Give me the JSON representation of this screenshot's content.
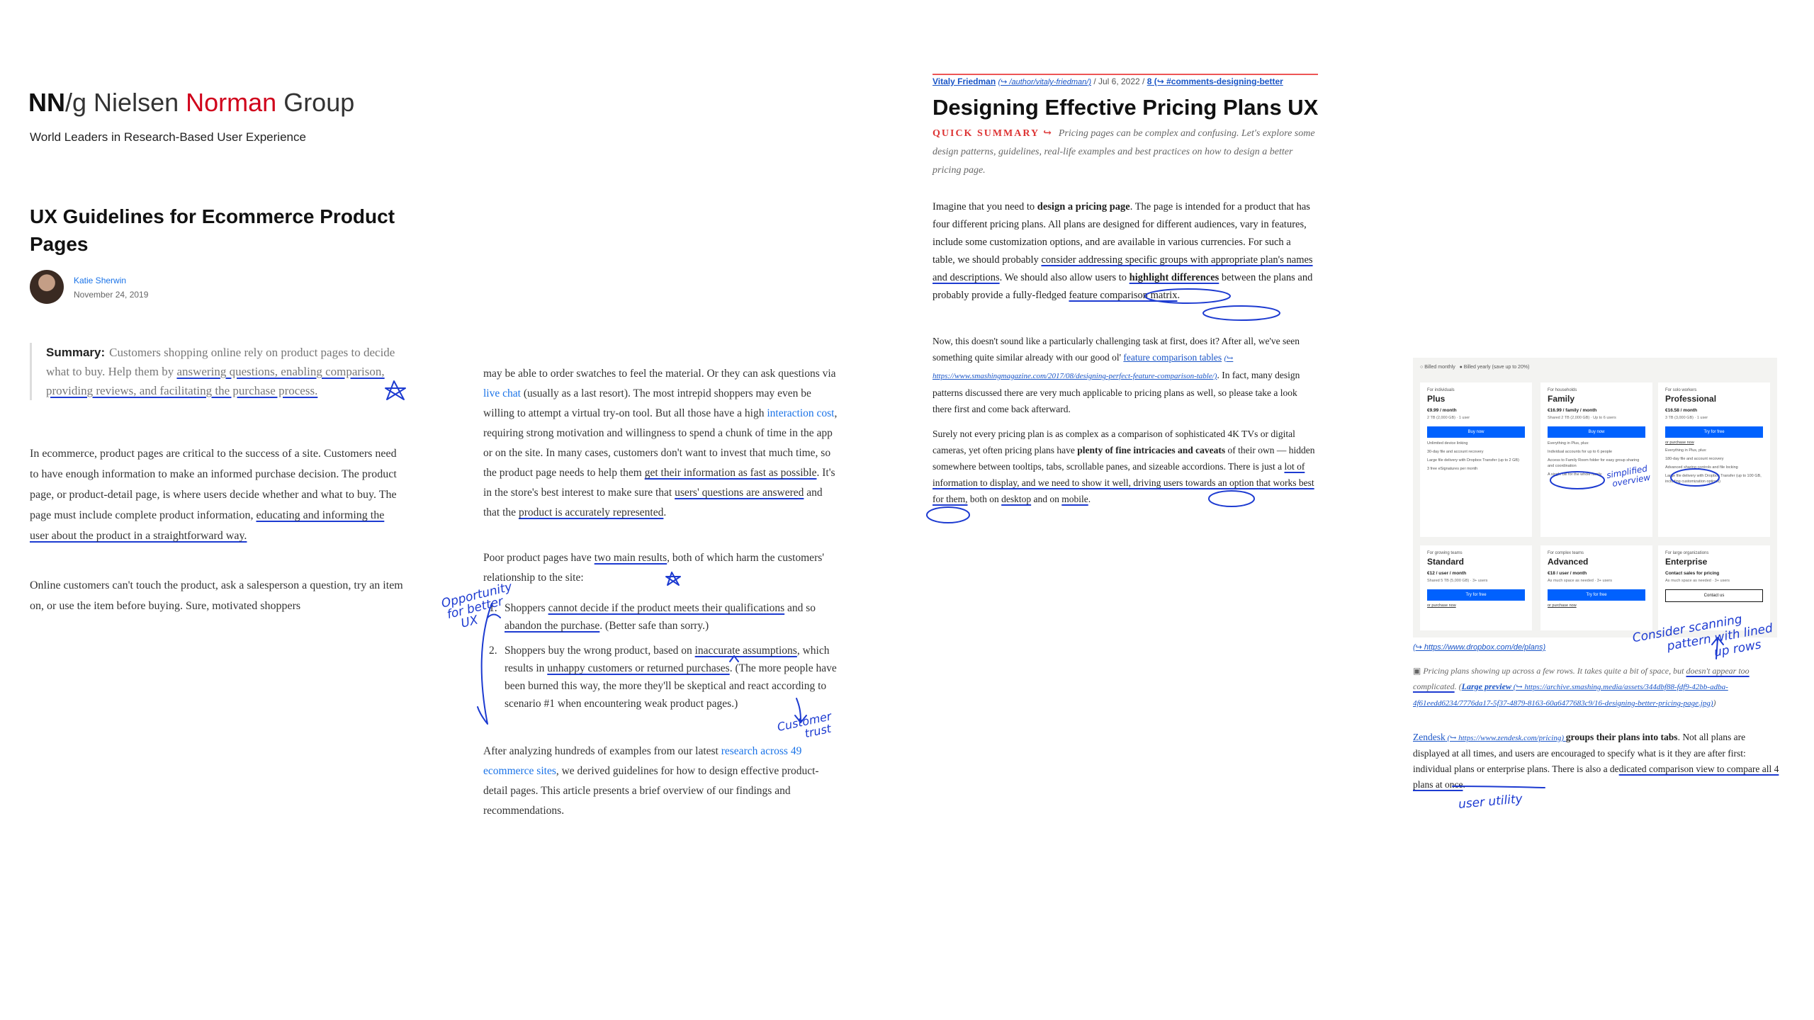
{
  "nng": {
    "logo_nn": "NN",
    "logo_g": "/g",
    "logo_nielsen": "Nielsen",
    "logo_norman": "Norman",
    "logo_group": "Group",
    "tagline": "World Leaders in Research-Based User Experience",
    "title": "UX Guidelines for Ecommerce Product Pages",
    "author": "Katie Sherwin",
    "date": "November 24, 2019",
    "summary_label": "Summary:",
    "summary_a": "Customers shopping online rely on product pages to decide what to buy. Help them by ",
    "summary_b": "answering questions, enabling comparison, providing reviews, and facilitating the purchase process.",
    "p1_a": "In ecommerce, product pages are critical to the success of a site. Customers need to have enough information to make an informed purchase decision. The product page, or product-detail page, is where users decide whether and what to buy. The page must include complete product information, ",
    "p1_b": "educating and informing the user about the product in a straightforward way.",
    "p2": "Online customers can't touch the product, ask a salesperson a question, try an item on, or use the item before buying. Sure, motivated shoppers"
  },
  "col2": {
    "p1_a": "may be able to order swatches to feel the material. Or they can ask questions via ",
    "p1_link1": "live chat",
    "p1_b": " (usually as a last resort). The most intrepid shoppers may even be willing to attempt a virtual try-on tool. But all those  have a high ",
    "p1_link2": "interaction cost",
    "p1_c": ", requiring strong motivation and willingness to spend a chunk of time in the app or on the site. In many cases, customers don't want to invest that much time, so the product page needs to help them ",
    "p1_d": "get their information as fast as possible",
    "p1_e": ". It's in the store's best interest to make sure that ",
    "p1_f": "users' questions are answered",
    "p1_g": " and that the ",
    "p1_h": "product is accurately represented",
    "p1_i": ".",
    "p2_a": "Poor product pages have ",
    "p2_b": "two main results",
    "p2_c": ", both of which harm the customers' relationship to the site:",
    "li1_num": "1.",
    "li1_a": "Shoppers ",
    "li1_b": "cannot decide if the product meets their qualifications",
    "li1_c": " and so ",
    "li1_d": "abandon the purchase",
    "li1_e": ". (Better safe than sorry.)",
    "li2_num": "2.",
    "li2_a": "Shoppers buy the wrong product, based on ",
    "li2_b": "inaccurate assumptions",
    "li2_c": ", which results in ",
    "li2_d": "unhappy customers or returned purchases",
    "li2_e": ". (The more people have been burned this way, the more they'll be skeptical and react according to scenario #1 when encountering weak product pages.)",
    "p3_a": "After analyzing hundreds of examples from our latest ",
    "p3_link": "research across 49 ecommerce sites",
    "p3_b": ", we derived guidelines for how to design effective product-detail pages. This article presents a brief overview of our findings and recommendations."
  },
  "smashing": {
    "author": "Vitaly Friedman",
    "author_url": "(↪ /author/vitaly-friedman/)",
    "date": " / Jul 6, 2022 / ",
    "comments": "8 (↪ #comments-designing-better",
    "title": "Designing Effective Pricing Plans UX",
    "summary_label": "QUICK SUMMARY ↪",
    "summary": "Pricing pages can be complex and confusing. Let's explore some design patterns, guidelines, real-life examples and best practices on how to design a better pricing page.",
    "p1_a": "Imagine that you need to ",
    "p1_b": "design a pricing page",
    "p1_c": ". The page is intended for a product that has four different pricing plans. All plans are designed for different audiences, vary in features, include some customization options, and are available in various currencies. For such a table, we should probably ",
    "p1_d": "consider addressing specific groups with appropriate plan's names and descriptions",
    "p1_e": ". We should also allow users to ",
    "p1_f": "highlight differences",
    "p1_g": " between the plans and probably provide a fully-fledged ",
    "p1_h": "feature comparison matrix",
    "p1_i": ".",
    "p2_a": "Now, this doesn't sound like a particularly challenging task at first, does it? After all, we've seen something quite similar already with our good ol' ",
    "p2_link": "feature comparison tables",
    "p2_url": "(↪ https://www.smashingmagazine.com/2017/08/designing-perfect-feature-comparison-table/)",
    "p2_b": ". In fact, many design patterns discussed there are very much applicable to pricing plans as well, so please take a look there first and come back afterward.",
    "p3_a": "Surely not every pricing plan is as complex as a comparison of sophisticated 4K TVs or digital cameras, yet often pricing plans have ",
    "p3_b": "plenty of fine intricacies and caveats",
    "p3_c": " of their own — hidden somewhere between tooltips, tabs, scrollable panes, and sizeable accordions. There is just a ",
    "p3_d": "lot of information to display, and we need to show it well, driving users towards an option that works best for them,",
    "p3_e": " both on ",
    "p3_f": "desktop",
    "p3_g": " and on ",
    "p3_h": "mobile",
    "p3_i": "."
  },
  "dropbox": {
    "toggle_monthly": "Billed monthly",
    "toggle_yearly": "Billed yearly (save up to 20%)",
    "plans": [
      {
        "aud": "For individuals",
        "name": "Plus",
        "price": "€9.99 / month",
        "storage": "2 TB (2,000 GB) · 1 user",
        "cta": "Buy now",
        "outline": false,
        "link": "",
        "features": [
          "Unlimited device linking",
          "30-day file and account recovery",
          "Large file delivery with Dropbox Transfer (up to 2 GB)",
          "3 free eSignatures per month"
        ]
      },
      {
        "aud": "For households",
        "name": "Family",
        "price": "€16.99 / family / month",
        "storage": "Shared 2 TB (2,000 GB) · Up to 6 users",
        "cta": "Buy now",
        "outline": false,
        "link": "",
        "features": [
          "Everything in Plus, plus:",
          "Individual accounts for up to 6 people",
          "Access to Family Room folder for easy group sharing and coordination",
          "A single bill for the whole family"
        ]
      },
      {
        "aud": "For solo workers",
        "name": "Professional",
        "price": "€16.58 / month",
        "storage": "3 TB (3,000 GB) · 1 user",
        "cta": "Try for free",
        "outline": false,
        "link": "or purchase now",
        "features": [
          "Everything in Plus, plus:",
          "180-day file and account recovery",
          "Advanced sharing controls and file locking",
          "Large file delivery with Dropbox Transfer (up to 100 GB, including customization options)"
        ]
      },
      {
        "aud": "For growing teams",
        "name": "Standard",
        "price": "€12 / user / month",
        "storage": "Shared 5 TB (5,000 GB) · 3+ users",
        "cta": "Try for free",
        "outline": false,
        "link": "or purchase now",
        "features": []
      },
      {
        "aud": "For complex teams",
        "name": "Advanced",
        "price": "€18 / user / month",
        "storage": "As much space as needed · 3+ users",
        "cta": "Try for free",
        "outline": false,
        "link": "or purchase now",
        "features": []
      },
      {
        "aud": "For large organizations",
        "name": "Enterprise",
        "price": "Contact sales for pricing",
        "storage": "As much space as needed · 3+ users",
        "cta": "Contact us",
        "outline": true,
        "link": "",
        "features": []
      }
    ],
    "source": "(↪ https://www.dropbox.com/de/plans)",
    "caption_a": "Pricing plans showing up across a few rows. It takes quite a bit of space, but ",
    "caption_b": "doesn't appear too complicated",
    "caption_c": ". (",
    "caption_link": "Large preview",
    "caption_url": " (↪ https://archive.smashing.media/assets/344dbf88-fdf9-42bb-adba-4f61eedd6234/7776da17-5f37-4879-8163-60a6477683c9/16-designing-better-pricing-page.jpg)",
    "caption_d": ")",
    "p_link": "Zendesk",
    "p_url": " (↪ https://www.zendesk.com/pricing) ",
    "p_bold": "groups their plans into tabs",
    "p_a": ". Not all plans are displayed at all times, and users are encouraged to specify what is it they are after first: individual plans or enterprise plans. There is also a de",
    "p_b": "dicated comparison view to compare all 4 plans at once",
    "p_c": "."
  },
  "handwriting": {
    "opportunity": [
      "Opportunity",
      "for better",
      "UX"
    ],
    "customer_trust": [
      "Customer",
      "trust"
    ],
    "simplified": [
      "simplified",
      "overview"
    ],
    "scanning": [
      "Consider scanning",
      "pattern with lined",
      "up rows"
    ],
    "user_utility": "user utility"
  },
  "colors": {
    "ink": "#1d3bd1",
    "nng_red": "#d0021b",
    "link": "#1a73e8",
    "dropbox_blue": "#0061fe"
  }
}
